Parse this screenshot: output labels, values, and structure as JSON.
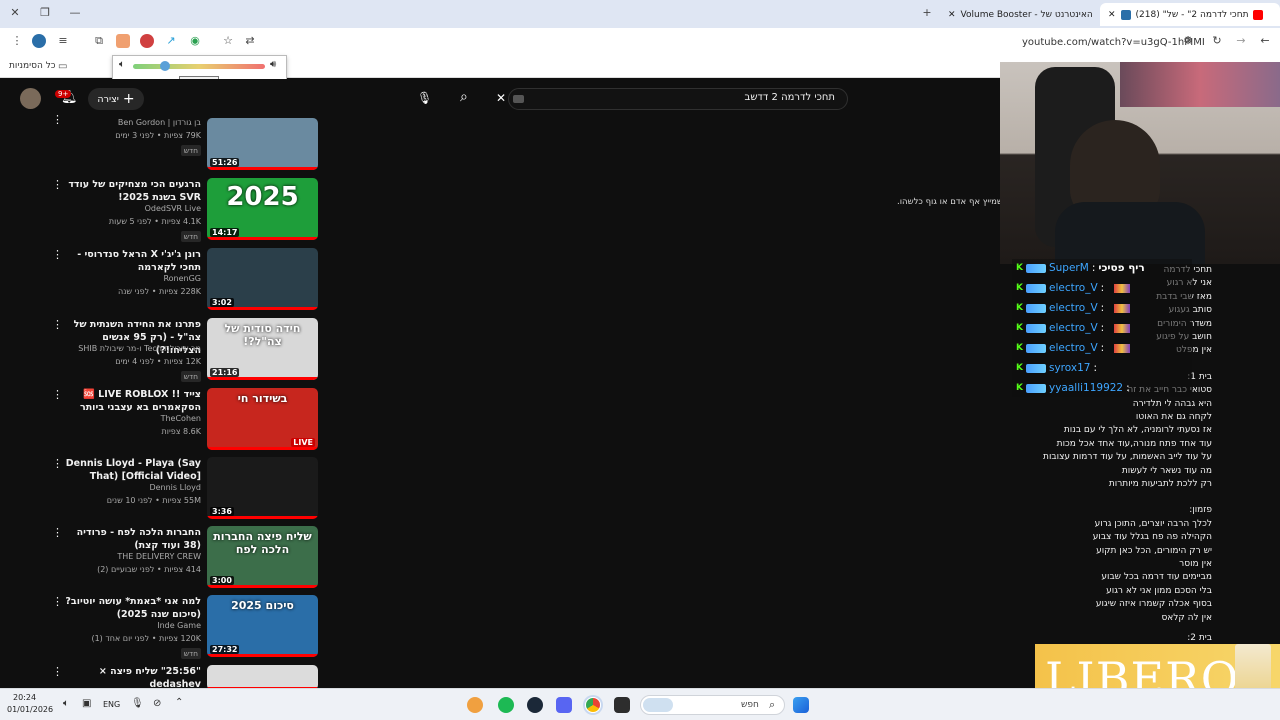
{
  "browser": {
    "tabs": [
      {
        "label": "(218) \"תחכי לדרמה 2\" - של",
        "active": true
      },
      {
        "label": "Volume Booster - האינטרנט של",
        "active": false
      }
    ],
    "new_tab_icon": "plus-icon",
    "url": "youtube.com/watch?v=u3gQ-1hPIMI",
    "bookmarks_label": "כל הסימניות",
    "window_controls": [
      "minimize",
      "restore",
      "close"
    ]
  },
  "volume_booster": {
    "turn_off_label": "Turn Off",
    "level_percent": 24
  },
  "youtube": {
    "search_query": "תחכי לדרמה 2 דדשב",
    "create_label": "יצירה",
    "notifications_count": "9+",
    "background_caption": "שמייץ אף אדם או גוף כלשהו.",
    "videos": [
      {
        "title": "",
        "channel": "בן גורדון | Ben Gordon",
        "meta": "79K צפיות • לפני 3 ימים",
        "badge": "חדש",
        "duration": "51:26",
        "thumb": "#6a8aa0"
      },
      {
        "title": "הרגעים הכי מצחיקים של עודד SVR בשנת 2025!",
        "channel": "OdedSVR Live",
        "meta": "4.1K צפיות • לפני 5 שעות",
        "badge": "חדש",
        "duration": "14:17",
        "thumb": "#1e9e3a"
      },
      {
        "title": "רונן ג'יג'י X הראל סנדרוסי - תחכי לקארמה",
        "channel": "RonenGG",
        "meta": "228K צפיות • לפני שנה",
        "badge": "",
        "duration": "3:02",
        "thumb": "#2b3f4a"
      },
      {
        "title": "פתרנו את החידה השנתית של צה\"ל - (רק 95 אנשים הצליחו!?)",
        "channel": "מר שיבולת Tech ו-מר שיבולת SHIB",
        "meta": "12K צפיות • לפני 4 ימים",
        "badge": "חדש",
        "duration": "21:16",
        "thumb": "#d8d8d8"
      },
      {
        "title": "צייד !! 🆘 LIVE ROBLOX הסקאמרים בא עצבני ביותר",
        "channel": "TheCohen",
        "meta": "8.6K צפיות",
        "badge": "",
        "duration": "",
        "thumb": "#c7261e"
      },
      {
        "title": "Dennis Lloyd - Playa (Say That) [Official Video]",
        "channel": "Dennis Lloyd",
        "meta": "55M צפיות • לפני 10 שנים",
        "badge": "",
        "duration": "3:36",
        "thumb": "#1a1a1a"
      },
      {
        "title": "החברות הלכה לפח - פרודיה (38 ועוד קצת)",
        "channel": "THE DELIVERY CREW",
        "meta": "414 צפיות • לפני שבועיים (2)",
        "badge": "",
        "duration": "3:00",
        "thumb": "#3c6e4a"
      },
      {
        "title": "למה אני *באמת* עושה יוטיוב? (סיכום שנה 2025)",
        "channel": "Inde Game",
        "meta": "120K צפיות • לפני יום אחד (1)",
        "badge": "חדש",
        "duration": "27:32",
        "thumb": "#2a6ea8"
      },
      {
        "title": "\"25:56\" שליח פיצה × dedashev",
        "channel": "THE DELIVERY CREW",
        "meta": "",
        "badge": "",
        "duration": "",
        "thumb": "#dcdcdc"
      }
    ],
    "thumb_texts": {
      "v2": "2025",
      "v4": "חידה סודית של צה\"ל?!",
      "v5": "בשידור חי",
      "v7": "שליח פיצה החברות הלכה לפח",
      "v8": "סיכום 2025"
    },
    "lyrics": [
      "תחכי לדרמה",
      "אני לא רגוע",
      "מאז שבי בדבת",
      "סותב געגוע",
      "משדר הימורים",
      "חושב על פיגוע",
      "אין מפלט",
      "בית 1:",
      "סטואי כבר חייב את זה",
      "היא גבהה לי תלדירה",
      "לקחה גם את האוטו",
      "אז נסעתי לרומניה, לא הלך לי עם בנות",
      "עוד אחד פתח מנורה,עוד אחד אכל מכות",
      "על עוד לייב האשמות, על עוד דרמות עצובות",
      "מה עוד נשאר לי לעשות",
      "רק ללכת לתביעות מיותרות",
      "פזמון:",
      "לכלך הרבה יוצרים, התוכן גרוע",
      "הקהילה פה פח בגלל עוד צבוע",
      "יש רק הימורים, הכל כאן תקוע",
      "אין מוסר",
      "מביימים עוד דרמה בכל שבוע",
      "בלי הסכם ממון אני לא רגוע",
      "בסוף אכלה קשמרו איזה שיגוע",
      "אין לה קלאס",
      "בית 2:"
    ]
  },
  "chat": {
    "messages": [
      {
        "user": "SuperM",
        "text": "ריף פסיכי"
      },
      {
        "user": "electro_V",
        "text": ""
      },
      {
        "user": "electro_V",
        "text": ""
      },
      {
        "user": "electro_V",
        "text": ""
      },
      {
        "user": "electro_V",
        "text": ""
      },
      {
        "user": "syrox17",
        "text": ""
      },
      {
        "user": "yyaalli119922",
        "text": ""
      }
    ]
  },
  "ad_overlay": {
    "brand": "LIBERO"
  },
  "taskbar": {
    "time": "20:24",
    "date": "01/01/2026",
    "language": "ENG",
    "search_label": "חפש"
  },
  "colors": {
    "yt_bg": "#0f0f0f",
    "kick_green": "#53fc18",
    "chat_name": "#3ea6ff",
    "accent_red": "#ff0000"
  }
}
